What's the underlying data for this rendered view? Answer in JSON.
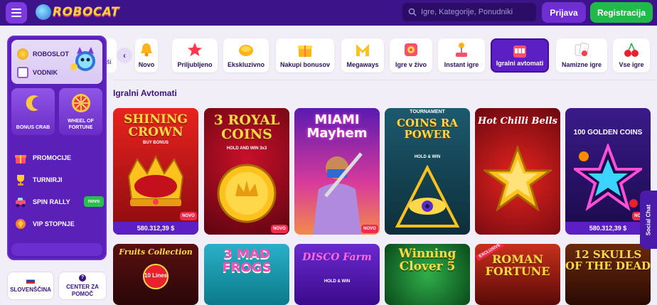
{
  "header": {
    "logo_text": "ROBOCAT",
    "search_placeholder": "Igre, Kategorije, Ponudniki",
    "login_label": "Prijava",
    "register_label": "Registracija"
  },
  "sidebar": {
    "top_items": [
      {
        "label": "ROBOSLOT",
        "icon": "robot-coin-icon"
      },
      {
        "label": "VODNIK",
        "icon": "guide-icon"
      }
    ],
    "tiles": [
      {
        "label": "BONUS CRAB",
        "icon": "bonus-crab-icon"
      },
      {
        "label": "WHEEL OF FORTUNE",
        "icon": "wheel-of-fortune-icon"
      }
    ],
    "menu": [
      {
        "label": "PROMOCIJE",
        "icon": "gift-icon"
      },
      {
        "label": "TURNIRJI",
        "icon": "trophy-icon"
      },
      {
        "label": "SPIN RALLY",
        "icon": "rally-icon",
        "badge": "novo"
      },
      {
        "label": "VIP STOPNJE",
        "icon": "vip-icon"
      }
    ],
    "language_label": "SLOVENŠČINA",
    "help_label": "CENTER ZA POMOČ"
  },
  "categories": {
    "partial_label": "ši",
    "items": [
      {
        "label": "Novo",
        "icon": "bell-icon"
      },
      {
        "label": "Priljubljeno",
        "icon": "star-icon"
      },
      {
        "label": "Ekskluzivno",
        "icon": "gem-icon"
      },
      {
        "label": "Nakupi bonusov",
        "icon": "giftbox-icon"
      },
      {
        "label": "Megaways",
        "icon": "megaways-icon"
      },
      {
        "label": "Igre v živo",
        "icon": "live-icon"
      },
      {
        "label": "Instant igre",
        "icon": "joystick-icon"
      },
      {
        "label": "Igralni avtomati",
        "icon": "slot-machine-icon",
        "active": true
      },
      {
        "label": "Namizne igre",
        "icon": "cards-icon"
      },
      {
        "label": "Vse igre",
        "icon": "cherries-icon"
      }
    ]
  },
  "section_title": "Igralni Avtomati",
  "games_row1": [
    {
      "title": "SHINING CROWN",
      "subtitle": "BUY BONUS",
      "price": "580.312,39 $",
      "novo": "NOVO"
    },
    {
      "title": "3 ROYAL COINS",
      "subtitle": "HOLD AND WIN 3x3",
      "novo": "NOVO"
    },
    {
      "title": "MIAMI Mayhem",
      "novo": "NOVO"
    },
    {
      "title": "COINS RA POWER",
      "subtitle": "HOLD & WIN",
      "top_label": "TOURNAMENT"
    },
    {
      "title": "Hot Chilli Bells"
    },
    {
      "title": "100 GOLDEN COINS",
      "price": "580.312,39 $",
      "novo": "NOVO"
    }
  ],
  "games_row2": [
    {
      "title": "Fruits Collection",
      "subtitle": "10 Lines"
    },
    {
      "title": "3 MAD FROGS"
    },
    {
      "title": "DISCO Farm",
      "subtitle": "HOLD & WIN"
    },
    {
      "title": "Winning Clover 5"
    },
    {
      "title": "ROMAN FORTUNE",
      "top_label": "EXCLUSIVE"
    },
    {
      "title": "12 SKULLS OF THE DEAD"
    }
  ],
  "social_chat_label": "Social Chat"
}
